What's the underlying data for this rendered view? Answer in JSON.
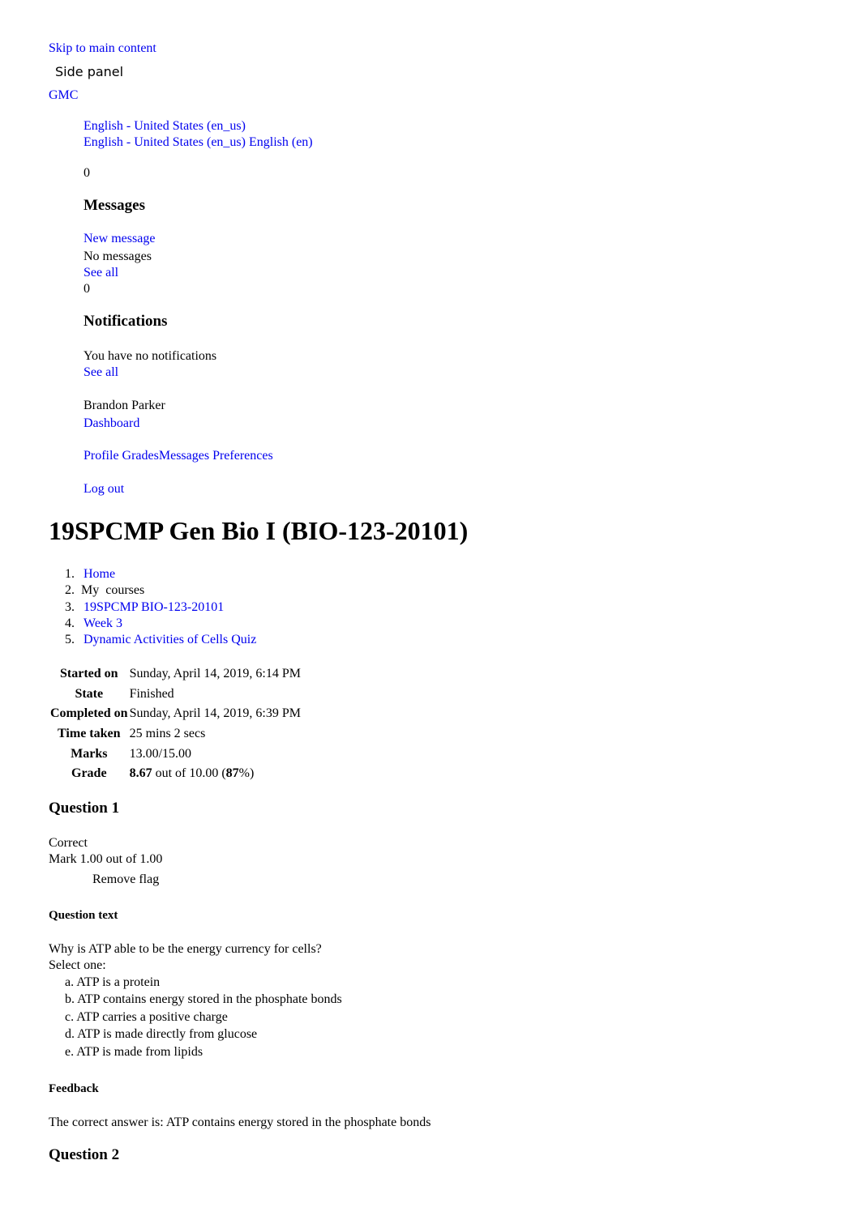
{
  "header": {
    "skip_link": "Skip to main content",
    "side_panel": "Side panel",
    "site_name": "GMC"
  },
  "language": {
    "current": "English - United States (en_us)",
    "options": [
      "English - United States (en_us)",
      "English (en)"
    ]
  },
  "messages": {
    "count": "0",
    "title": "Messages",
    "new_message": "New message",
    "empty": "No messages",
    "see_all": "See all"
  },
  "notifications": {
    "count": "0",
    "title": "Notifications",
    "empty": "You have no notifications",
    "see_all": "See all"
  },
  "user_menu": {
    "name": "Brandon Parker",
    "dashboard": "Dashboard",
    "links": [
      "Profile",
      "Grades",
      "Messages",
      "Preferences"
    ],
    "logout": "Log out"
  },
  "page": {
    "title": "19SPCMP Gen Bio I (BIO-123-20101)"
  },
  "breadcrumb": [
    {
      "num": "1.",
      "label": "Home",
      "link": true
    },
    {
      "num": "2.",
      "label": "My  courses",
      "link": false
    },
    {
      "num": "3.",
      "label": "19SPCMP BIO-123-20101",
      "link": true
    },
    {
      "num": "4.",
      "label": "Week 3",
      "link": true
    },
    {
      "num": "5.",
      "label": "Dynamic Activities of Cells Quiz",
      "link": true
    }
  ],
  "summary": {
    "started_on": {
      "label": "Started on",
      "value": "Sunday, April 14, 2019, 6:14 PM"
    },
    "state": {
      "label": "State",
      "value": "Finished"
    },
    "completed_on": {
      "label": "Completed on",
      "value": "Sunday, April 14, 2019, 6:39 PM"
    },
    "time_taken": {
      "label": "Time taken",
      "value": "25 mins 2 secs"
    },
    "marks": {
      "label": "Marks",
      "value": "13.00/15.00"
    },
    "grade": {
      "label": "Grade",
      "score": "8.67",
      "out_of": " out of 10.00 (",
      "percent": "87",
      "suffix": "%)"
    }
  },
  "questions": [
    {
      "title": "Question 1",
      "status": "Correct",
      "mark": "Mark 1.00 out of 1.00",
      "flag": "Remove flag",
      "text_heading": "Question text",
      "text": "Why is ATP able to be the energy currency for cells?",
      "prompt": "Select one:",
      "choices": [
        "a. ATP is a protein",
        "b. ATP contains energy stored in the phosphate bonds",
        "c. ATP carries a positive charge",
        "d. ATP is made directly from glucose",
        "e. ATP is made from lipids"
      ],
      "feedback_heading": "Feedback",
      "feedback": "The correct answer is: ATP contains energy stored in the phosphate bonds"
    },
    {
      "title": "Question 2"
    }
  ]
}
